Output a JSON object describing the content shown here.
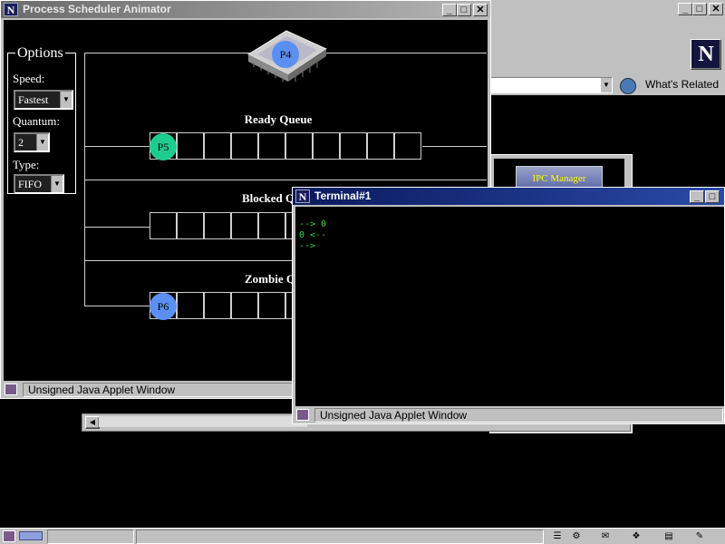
{
  "browser": {
    "search_value": "",
    "whats_related": "What's Related",
    "logo_letter": "N",
    "ipc_label": "IPC Manager"
  },
  "applet": {
    "title": "Process Scheduler Animator",
    "status": "Unsigned Java Applet Window",
    "chip_process": "P4",
    "options": {
      "title": "Options",
      "speed_label": "Speed:",
      "speed_value": "Fastest",
      "quantum_label": "Quantum:",
      "quantum_value": "2",
      "type_label": "Type:",
      "type_value": "FIFO"
    },
    "queues": [
      {
        "title": "Ready Queue",
        "process": "P5",
        "process_color": "#1fcc8f"
      },
      {
        "title": "Blocked Q",
        "process": "",
        "process_color": ""
      },
      {
        "title": "Zombie Q",
        "process": "P6",
        "process_color": "#5b8ff2"
      }
    ],
    "chip_color": "#5b8ff2"
  },
  "terminal": {
    "title": "Terminal#1",
    "lines": [
      "--> 0",
      "0 <--",
      "-->"
    ],
    "status": "Unsigned Java Applet Window"
  },
  "window_controls": {
    "min": "_",
    "max": "□",
    "close": "✕"
  }
}
